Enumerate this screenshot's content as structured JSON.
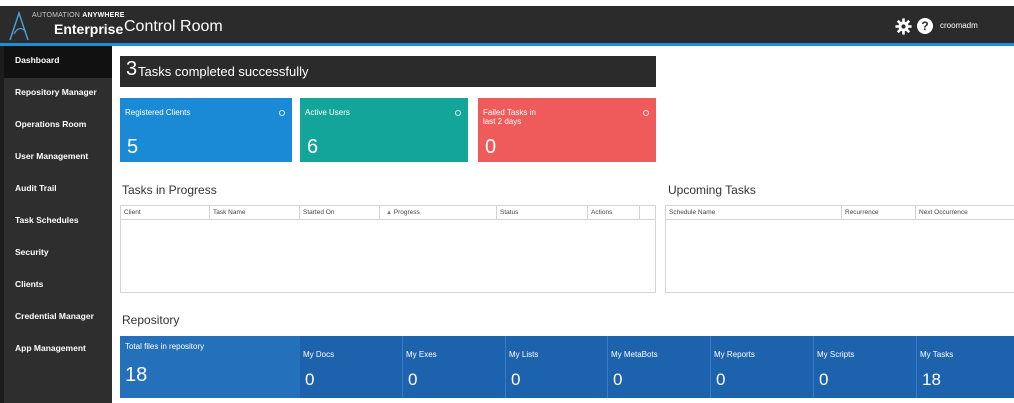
{
  "header": {
    "brand_top_prefix": "AUTOMATION",
    "brand_top_bold": "ANYWHERE",
    "brand_main": "Enterprise",
    "title": "Control Room",
    "username": "croomadm",
    "help_glyph": "?"
  },
  "sidebar": {
    "items": [
      {
        "label": "Dashboard",
        "active": true
      },
      {
        "label": "Repository Manager"
      },
      {
        "label": "Operations Room"
      },
      {
        "label": "User Management"
      },
      {
        "label": "Audit Trail"
      },
      {
        "label": "Task Schedules"
      },
      {
        "label": "Security"
      },
      {
        "label": "Clients"
      },
      {
        "label": "Credential Manager"
      },
      {
        "label": "App Management"
      }
    ]
  },
  "banner": {
    "count": "3",
    "text": "Tasks completed successfully"
  },
  "tiles": [
    {
      "label": "Registered Clients",
      "value": "5",
      "color": "#1a8ad6"
    },
    {
      "label": "Active Users",
      "value": "6",
      "color": "#13a59a"
    },
    {
      "label": "Failed Tasks in\nlast 2 days",
      "value": "0",
      "color": "#ef5b5b"
    }
  ],
  "tasks_in_progress": {
    "title": "Tasks in Progress",
    "columns": [
      "Client",
      "Task Name",
      "Started On",
      "Progress",
      "Status",
      "Actions"
    ]
  },
  "upcoming_tasks": {
    "title": "Upcoming Tasks",
    "columns": [
      "Schedule Name",
      "Recurrence",
      "Next Occurrence"
    ]
  },
  "repository": {
    "title": "Repository",
    "total_label": "Total files in repository",
    "total_value": "18",
    "cells": [
      {
        "label": "My Docs",
        "value": "0"
      },
      {
        "label": "My Exes",
        "value": "0"
      },
      {
        "label": "My Lists",
        "value": "0"
      },
      {
        "label": "My MetaBots",
        "value": "0"
      },
      {
        "label": "My Reports",
        "value": "0"
      },
      {
        "label": "My Scripts",
        "value": "0"
      },
      {
        "label": "My Tasks",
        "value": "18"
      }
    ]
  }
}
